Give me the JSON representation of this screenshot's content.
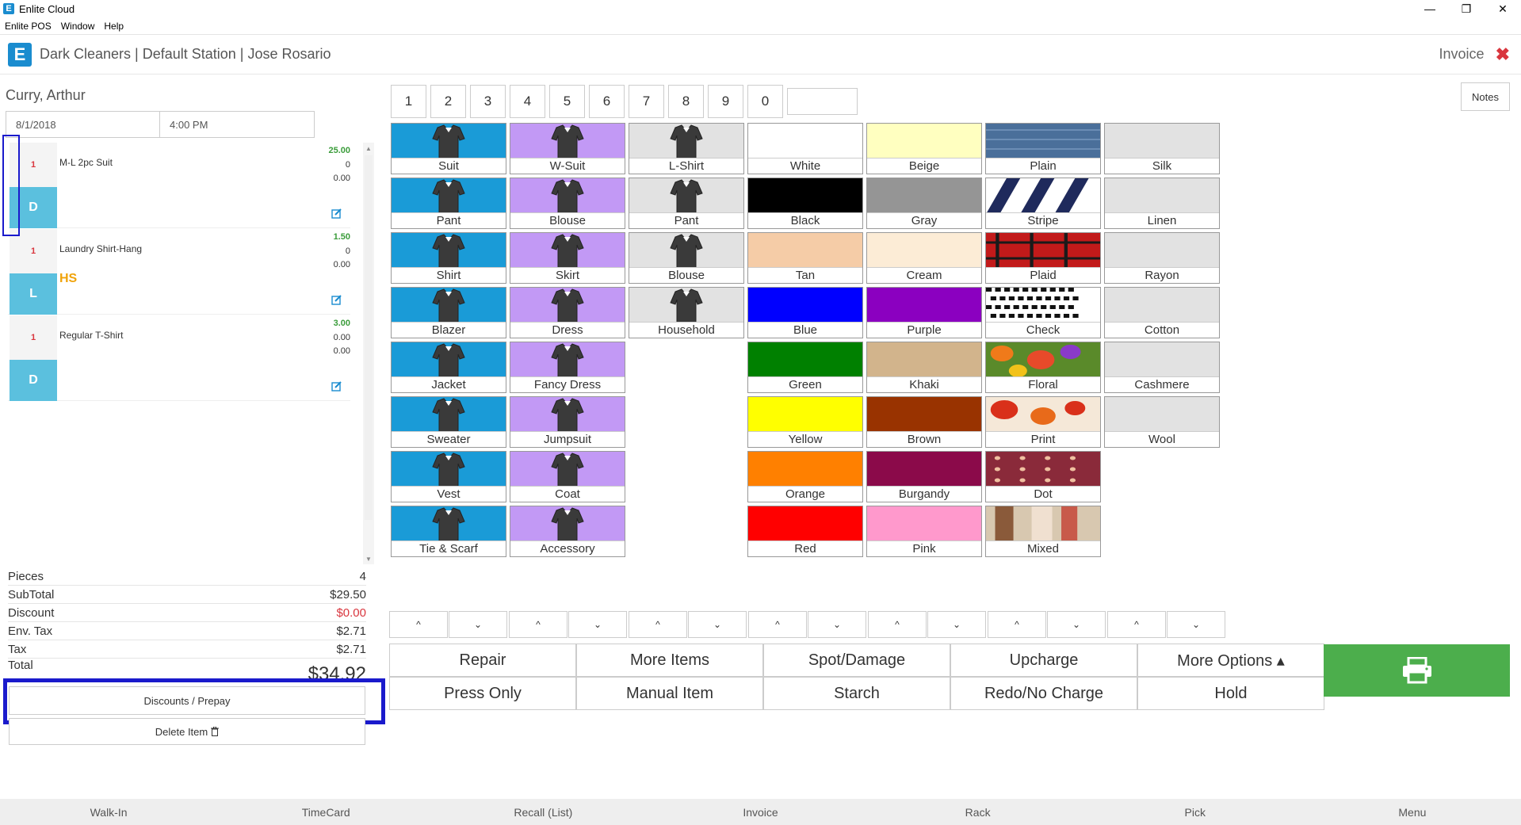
{
  "window": {
    "title": "Enlite Cloud",
    "logo_letter": "E",
    "min": "—",
    "max": "❐",
    "close": "✕"
  },
  "menu": [
    "Enlite POS",
    "Window",
    "Help"
  ],
  "header": {
    "title": "Dark Cleaners | Default Station | Jose Rosario",
    "right_label": "Invoice",
    "close": "✖",
    "logo_letter": "E"
  },
  "customer": {
    "name": "Curry, Arthur",
    "date": "8/1/2018",
    "time": "4:00 PM"
  },
  "items": [
    {
      "qty": "1",
      "code": "D",
      "name": "M-L 2pc Suit",
      "price": "25.00",
      "v1": "0",
      "v2": "0.00",
      "tag": ""
    },
    {
      "qty": "1",
      "code": "L",
      "name": "Laundry Shirt-Hang",
      "price": "1.50",
      "v1": "0",
      "v2": "0.00",
      "tag": "HS"
    },
    {
      "qty": "1",
      "code": "D",
      "name": "Regular T-Shirt",
      "price": "3.00",
      "v1": "0.00",
      "v2": "0.00",
      "tag": ""
    }
  ],
  "totals": {
    "pieces_label": "Pieces",
    "pieces": "4",
    "subtotal_label": "SubTotal",
    "subtotal": "$29.50",
    "discount_label": "Discount",
    "discount": "$0.00",
    "envtax_label": "Env. Tax",
    "envtax": "$2.71",
    "tax_label": "Tax",
    "tax": "$2.71",
    "total_label": "Total",
    "total": "$34.92"
  },
  "buttons": {
    "discounts": "Discounts / Prepay",
    "delete": "Delete Item",
    "notes": "Notes"
  },
  "numpad": [
    "1",
    "2",
    "3",
    "4",
    "5",
    "6",
    "7",
    "8",
    "9",
    "0"
  ],
  "garments_blue": [
    "Suit",
    "Pant",
    "Shirt",
    "Blazer",
    "Jacket",
    "Sweater",
    "Vest",
    "Tie & Scarf"
  ],
  "garments_purple": [
    "W-Suit",
    "Blouse",
    "Skirt",
    "Dress",
    "Fancy Dress",
    "Jumpsuit",
    "Coat",
    "Accessory"
  ],
  "garments_gray": [
    "L-Shirt",
    "Pant",
    "Blouse",
    "Household"
  ],
  "colors_a": [
    {
      "name": "White",
      "hex": "#ffffff"
    },
    {
      "name": "Black",
      "hex": "#000000"
    },
    {
      "name": "Tan",
      "hex": "#f5cca7"
    },
    {
      "name": "Blue",
      "hex": "#0000ff"
    },
    {
      "name": "Green",
      "hex": "#008000"
    },
    {
      "name": "Yellow",
      "hex": "#ffff00"
    },
    {
      "name": "Orange",
      "hex": "#ff8000"
    },
    {
      "name": "Red",
      "hex": "#ff0000"
    }
  ],
  "colors_b": [
    {
      "name": "Beige",
      "hex": "#ffffc0"
    },
    {
      "name": "Gray",
      "hex": "#959595"
    },
    {
      "name": "Cream",
      "hex": "#fcecd6"
    },
    {
      "name": "Purple",
      "hex": "#8b00c0"
    },
    {
      "name": "Khaki",
      "hex": "#d2b48c"
    },
    {
      "name": "Brown",
      "hex": "#993300"
    },
    {
      "name": "Burgandy",
      "hex": "#8b0a4a"
    },
    {
      "name": "Pink",
      "hex": "#ff99cc"
    }
  ],
  "patterns": [
    "Plain",
    "Stripe",
    "Plaid",
    "Check",
    "Floral",
    "Print",
    "Dot",
    "Mixed"
  ],
  "fabrics": [
    "Silk",
    "Linen",
    "Rayon",
    "Cotton",
    "Cashmere",
    "Wool"
  ],
  "arrows": {
    "up": "^",
    "down": "⌄"
  },
  "actions": [
    "Repair",
    "More Items",
    "Spot/Damage",
    "Upcharge",
    "More Options ▴",
    "Press Only",
    "Manual Item",
    "Starch",
    "Redo/No Charge",
    "Hold"
  ],
  "nav": [
    "Walk-In",
    "TimeCard",
    "Recall (List)",
    "Invoice",
    "Rack",
    "Pick",
    "Menu"
  ],
  "colors": {
    "accent": "#1a8ccf",
    "item_code": "#5bc0de",
    "garment_blue": "#1a9bd7",
    "garment_purple": "#c299f5",
    "print_green": "#4cae4c",
    "highlight": "#1a1acc"
  }
}
